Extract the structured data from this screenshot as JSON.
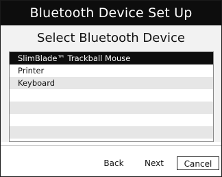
{
  "window": {
    "title": "Bluetooth Device Set Up"
  },
  "main": {
    "heading": "Select Bluetooth Device",
    "devices": [
      "SlimBlade™ Trackball Mouse",
      "Printer",
      "Keyboard",
      "",
      "",
      "",
      ""
    ],
    "selected_index": 0
  },
  "footer": {
    "back_label": "Back",
    "next_label": "Next",
    "cancel_label": "Cancel"
  },
  "colors": {
    "titlebar": "#0d0d0d",
    "selection": "#0d0d0d",
    "row_alt": "#e6e6e6",
    "panel": "#f2f2f2"
  }
}
